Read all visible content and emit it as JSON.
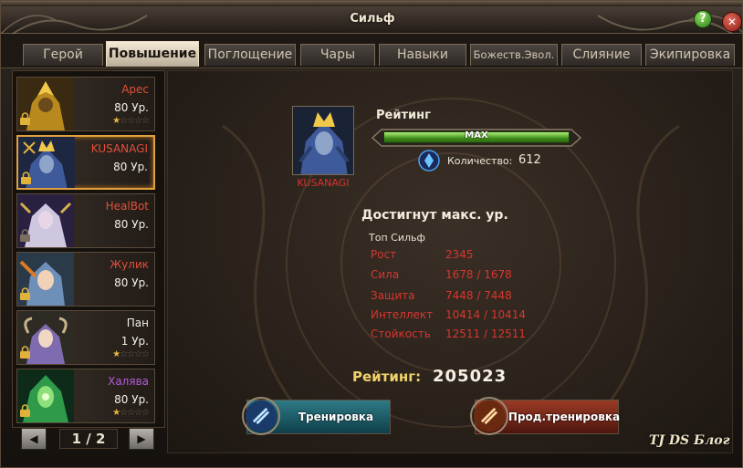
{
  "window": {
    "title": "Сильф",
    "help_label": "?",
    "close_label": "✕"
  },
  "tabs": [
    {
      "label": "Герой"
    },
    {
      "label": "Повышение"
    },
    {
      "label": "Поглощение"
    },
    {
      "label": "Чары"
    },
    {
      "label": "Навыки"
    },
    {
      "label": "Божеств.Эвол."
    },
    {
      "label": "Слияние"
    },
    {
      "label": "Экипировка"
    }
  ],
  "active_tab": "Повышение",
  "heroes": [
    {
      "name": "Арес",
      "name_color": "#e0503a",
      "level": "80 Ур.",
      "stars_filled": 1,
      "stars_total": 5,
      "locked": true
    },
    {
      "name": "KUSANAGI",
      "name_color": "#e0503a",
      "level": "80 Ур.",
      "stars_filled": 0,
      "stars_total": 0,
      "locked": true,
      "selected": true
    },
    {
      "name": "HealBot",
      "name_color": "#e0503a",
      "level": "80 Ур.",
      "stars_filled": 0,
      "stars_total": 0,
      "locked": true
    },
    {
      "name": "Жулик",
      "name_color": "#e0503a",
      "level": "80 Ур.",
      "stars_filled": 0,
      "stars_total": 0,
      "locked": true
    },
    {
      "name": "Пан",
      "name_color": "#f3efe7",
      "level": "1 Ур.",
      "stars_filled": 1,
      "stars_total": 5,
      "locked": true
    },
    {
      "name": "Халява",
      "name_color": "#b45ae0",
      "level": "80 Ур.",
      "stars_filled": 1,
      "stars_total": 5,
      "locked": true
    }
  ],
  "pager": {
    "prev": "◀",
    "label": "1 / 2",
    "next": "▶"
  },
  "detail": {
    "portrait_name": "KUSANAGI",
    "rating_label": "Рейтинг",
    "bar_text": "MAX",
    "bar_fill": 1.0,
    "count_label": "Количество:",
    "count_value": "612",
    "max_level_text": "Достигнут макс. ур.",
    "top_label": "Топ Сильф",
    "stats": [
      {
        "name": "Рост",
        "value": "2345"
      },
      {
        "name": "Сила",
        "value": "1678 / 1678"
      },
      {
        "name": "Защита",
        "value": "7448 / 7448"
      },
      {
        "name": "Интеллект",
        "value": "10414 / 10414"
      },
      {
        "name": "Стойкость",
        "value": "12511 / 12511"
      }
    ],
    "total_rating_label": "Рейтинг:",
    "total_rating_value": "205023",
    "train_button": "Тренировка",
    "adv_train_button_line1": "Прод.",
    "adv_train_button_line2": "тренировка"
  },
  "watermark": "TJ DS Блог",
  "icons": {
    "help": "help-icon",
    "close": "close-icon",
    "lock": "lock-icon",
    "star": "star-icon",
    "crystal": "crystal-icon",
    "train": "train-icon",
    "adv_train": "advanced-train-icon",
    "prev": "arrow-left-icon",
    "next": "arrow-right-icon"
  },
  "colors": {
    "accent_gold": "#f1d26a",
    "stat_red": "#d7362f",
    "selected_border": "#e0a040",
    "bar_green": "#3f8c19"
  }
}
